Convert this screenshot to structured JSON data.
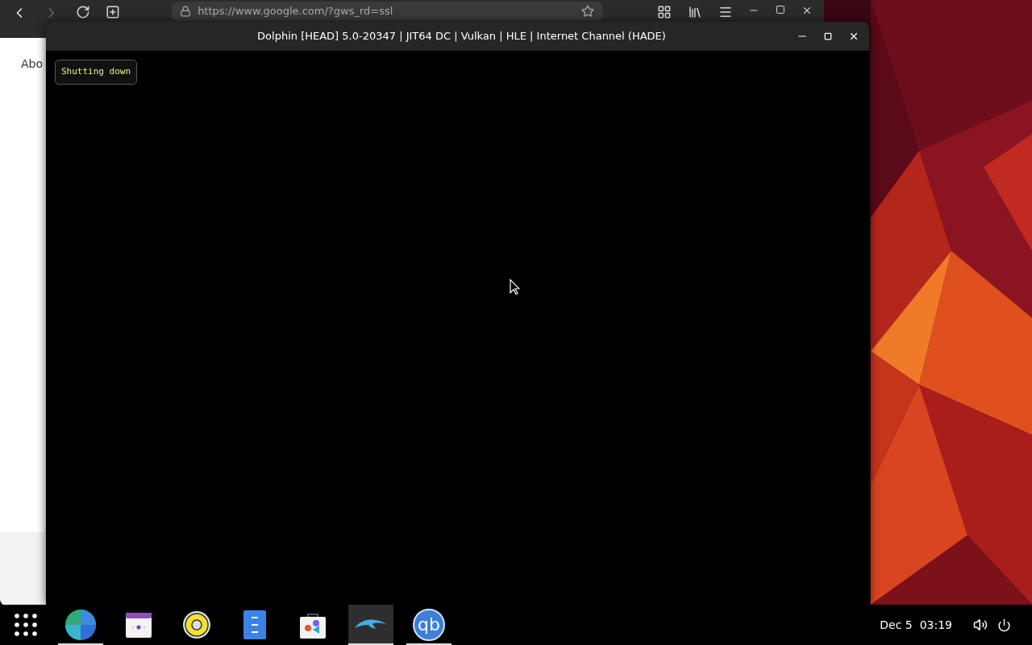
{
  "browser": {
    "url": "https://www.google.com/?gws_rd=ssl",
    "forward_disabled": true,
    "page_text": "Abo"
  },
  "dolphin": {
    "title": "Dolphin [HEAD] 5.0-20347 | JIT64 DC | Vulkan | HLE | Internet Channel (HADE)",
    "osd": "Shutting down"
  },
  "taskbar": {
    "apps": [
      {
        "kind": "globe",
        "running": true,
        "selected": false
      },
      {
        "kind": "calendar",
        "running": false,
        "selected": false
      },
      {
        "kind": "speaker",
        "running": false,
        "selected": false
      },
      {
        "kind": "files",
        "running": false,
        "selected": false
      },
      {
        "kind": "store",
        "running": false,
        "selected": false
      },
      {
        "kind": "dolphin",
        "running": true,
        "selected": true
      },
      {
        "kind": "qb",
        "running": true,
        "selected": false,
        "text": "qb"
      }
    ],
    "clock": "Dec 5  03:19"
  }
}
